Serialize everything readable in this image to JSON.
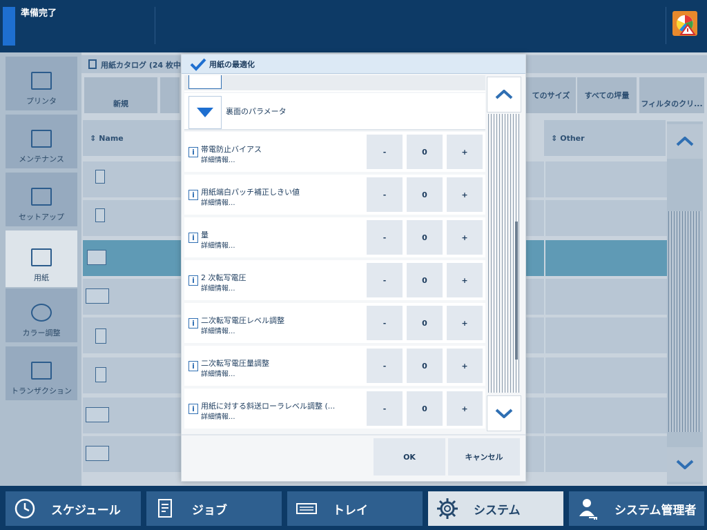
{
  "status": {
    "text": "準備完了"
  },
  "nav": {
    "items": [
      {
        "label": "プリンタ",
        "icon": "printer-icon"
      },
      {
        "label": "メンテナンス",
        "icon": "maintenance-icon"
      },
      {
        "label": "セットアップ",
        "icon": "setup-icon"
      },
      {
        "label": "用紙",
        "icon": "paper-icon",
        "active": true
      },
      {
        "label": "カラー調整",
        "icon": "color-adjust-icon"
      },
      {
        "label": "トランザクション",
        "icon": "transaction-icon"
      }
    ]
  },
  "catalog": {
    "title": "用紙カタログ (24 枚中、",
    "toolbar": {
      "new_label": "新規",
      "all_sizes": "てのサイズ",
      "all_weights": "すべての坪量",
      "filter_clear": "フィルタのクリ..."
    },
    "columns": {
      "name": "Name",
      "other": "Other"
    }
  },
  "dialog": {
    "title": "用紙の最適化",
    "section_label": "裏面のパラメータ",
    "detail_label": "詳細情報...",
    "params": [
      {
        "name": "帯電防止バイアス",
        "value": "0"
      },
      {
        "name": "用紙端白パッチ補正しきい値",
        "value": "0"
      },
      {
        "name": "量",
        "value": "0"
      },
      {
        "name": "2 次転写電圧",
        "value": "0"
      },
      {
        "name": "二次転写電圧レベル調整",
        "value": "0"
      },
      {
        "name": "二次転写電圧量調整",
        "value": "0"
      },
      {
        "name": "用紙に対する斜送ローラレベル調整 (...",
        "value": "0"
      }
    ],
    "minus_label": "-",
    "plus_label": "+",
    "ok_label": "OK",
    "cancel_label": "キャンセル"
  },
  "bottom_tabs": [
    {
      "label": "スケジュール",
      "icon": "clock-icon"
    },
    {
      "label": "ジョブ",
      "icon": "job-icon"
    },
    {
      "label": "トレイ",
      "icon": "tray-icon"
    },
    {
      "label": "システム",
      "icon": "gear-icon",
      "active": true
    },
    {
      "label": "システム管理者",
      "icon": "admin-icon"
    }
  ],
  "colors": {
    "accent": "#2f6fb3",
    "header_bg": "#0d3a66",
    "selected_row": "#5f9ab5"
  }
}
